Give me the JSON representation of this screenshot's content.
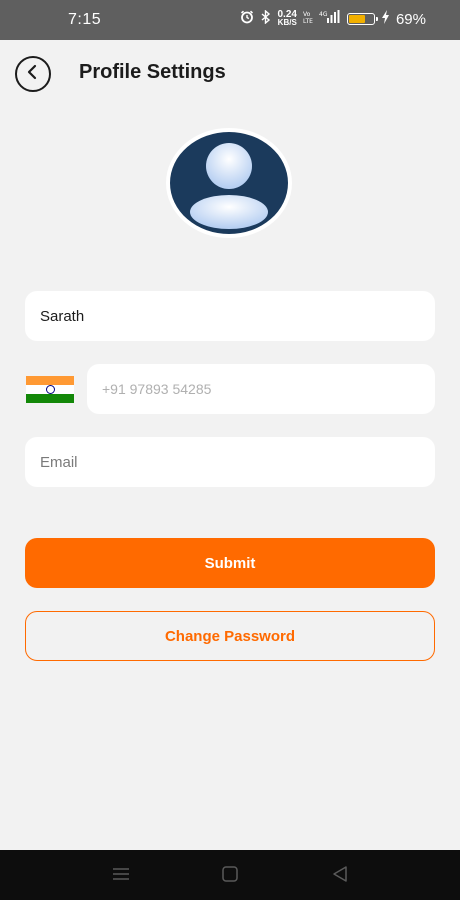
{
  "status_bar": {
    "time": "7:15",
    "speed_value": "0.24",
    "speed_unit": "KB/S",
    "battery_percent_label": "69%",
    "battery_level": 0.69
  },
  "header": {
    "title": "Profile Settings",
    "back_icon": "chevron-left-circle-icon"
  },
  "profile": {
    "avatar_icon": "user-avatar-icon"
  },
  "form": {
    "name_value": "Sarath",
    "phone_flag_icon": "india-flag-icon",
    "phone_placeholder": "+91 97893 54285",
    "email_placeholder": "Email"
  },
  "actions": {
    "submit_label": "Submit",
    "change_password_label": "Change Password"
  },
  "colors": {
    "accent": "#ff6a00",
    "avatar_bg": "#1b3a5c",
    "status_bar_bg": "#5f5f5f",
    "nav_bar_bg": "#0d0d0d",
    "page_bg": "#f2f2f2"
  }
}
